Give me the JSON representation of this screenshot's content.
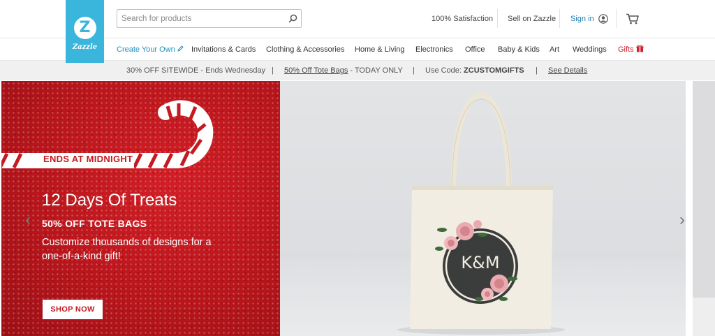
{
  "brand": {
    "logo_text": "Zazzle",
    "logo_letter": "Z",
    "accent": "#3ab5dc"
  },
  "search": {
    "placeholder": "Search for products",
    "value": ""
  },
  "header": {
    "satisfaction": "100% Satisfaction",
    "sell": "Sell on Zazzle",
    "sign_in": "Sign in"
  },
  "nav": {
    "items": [
      "Create Your Own",
      "Invitations & Cards",
      "Clothing & Accessories",
      "Home & Living",
      "Electronics",
      "Office",
      "Baby & Kids",
      "Art",
      "Weddings",
      "Gifts"
    ]
  },
  "promo": {
    "part1": "30% OFF SITEWIDE - Ends Wednesday",
    "sep": "|",
    "part2_link": "50% Off Tote Bags",
    "part2_rest": " - TODAY ONLY",
    "part3_label": "Use Code: ",
    "part3_code": "ZCUSTOMGIFTS",
    "details": "See Details"
  },
  "hero": {
    "banner": "ENDS AT MIDNIGHT",
    "title": "12 Days Of Treats",
    "subtitle": "50% OFF TOTE BAGS",
    "body": "Customize thousands of designs for a one-of-a-kind gift!",
    "cta": "SHOP NOW",
    "monogram": "K&M",
    "prev": "‹",
    "next": "›"
  },
  "colors": {
    "promo_red": "#c41a21",
    "gifts_red": "#d0202e",
    "link_blue": "#1f8fbf"
  }
}
